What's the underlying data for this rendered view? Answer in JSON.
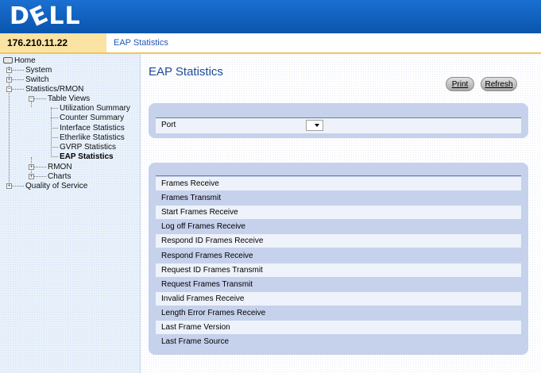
{
  "brand": {
    "logo_text": "DELL"
  },
  "ipbar": {
    "ip": "176.210.11.22",
    "breadcrumb": "EAP Statistics"
  },
  "nav": {
    "home": "Home",
    "system": "System",
    "switch": "Switch",
    "stats_rmon": "Statistics/RMON",
    "table_views": "Table Views",
    "utilization_summary": "Utilization Summary",
    "counter_summary": "Counter Summary",
    "interface_statistics": "Interface Statistics",
    "etherlike_statistics": "Etherlike Statistics",
    "gvrp_statistics": "GVRP Statistics",
    "eap_statistics": "EAP Statistics",
    "rmon": "RMON",
    "charts": "Charts",
    "qos": "Quality of Service"
  },
  "main": {
    "title": "EAP Statistics",
    "print_label": "Print",
    "refresh_label": "Refresh",
    "port_label": "Port",
    "port_value": ""
  },
  "stats": [
    "Frames Receive",
    "Frames Transmit",
    "Start Frames Receive",
    "Log off Frames Receive",
    "Respond ID Frames Receive",
    "Respond Frames Receive",
    "Request ID Frames Transmit",
    "Request Frames Transmit",
    "Invalid Frames Receive",
    "Length Error Frames Receive",
    "Last Frame Version",
    "Last Frame Source"
  ],
  "colors": {
    "header": "#0d5db8",
    "ip_bg": "#fbe3a3",
    "panel": "#c6d1ec",
    "title": "#1d4a9a"
  }
}
